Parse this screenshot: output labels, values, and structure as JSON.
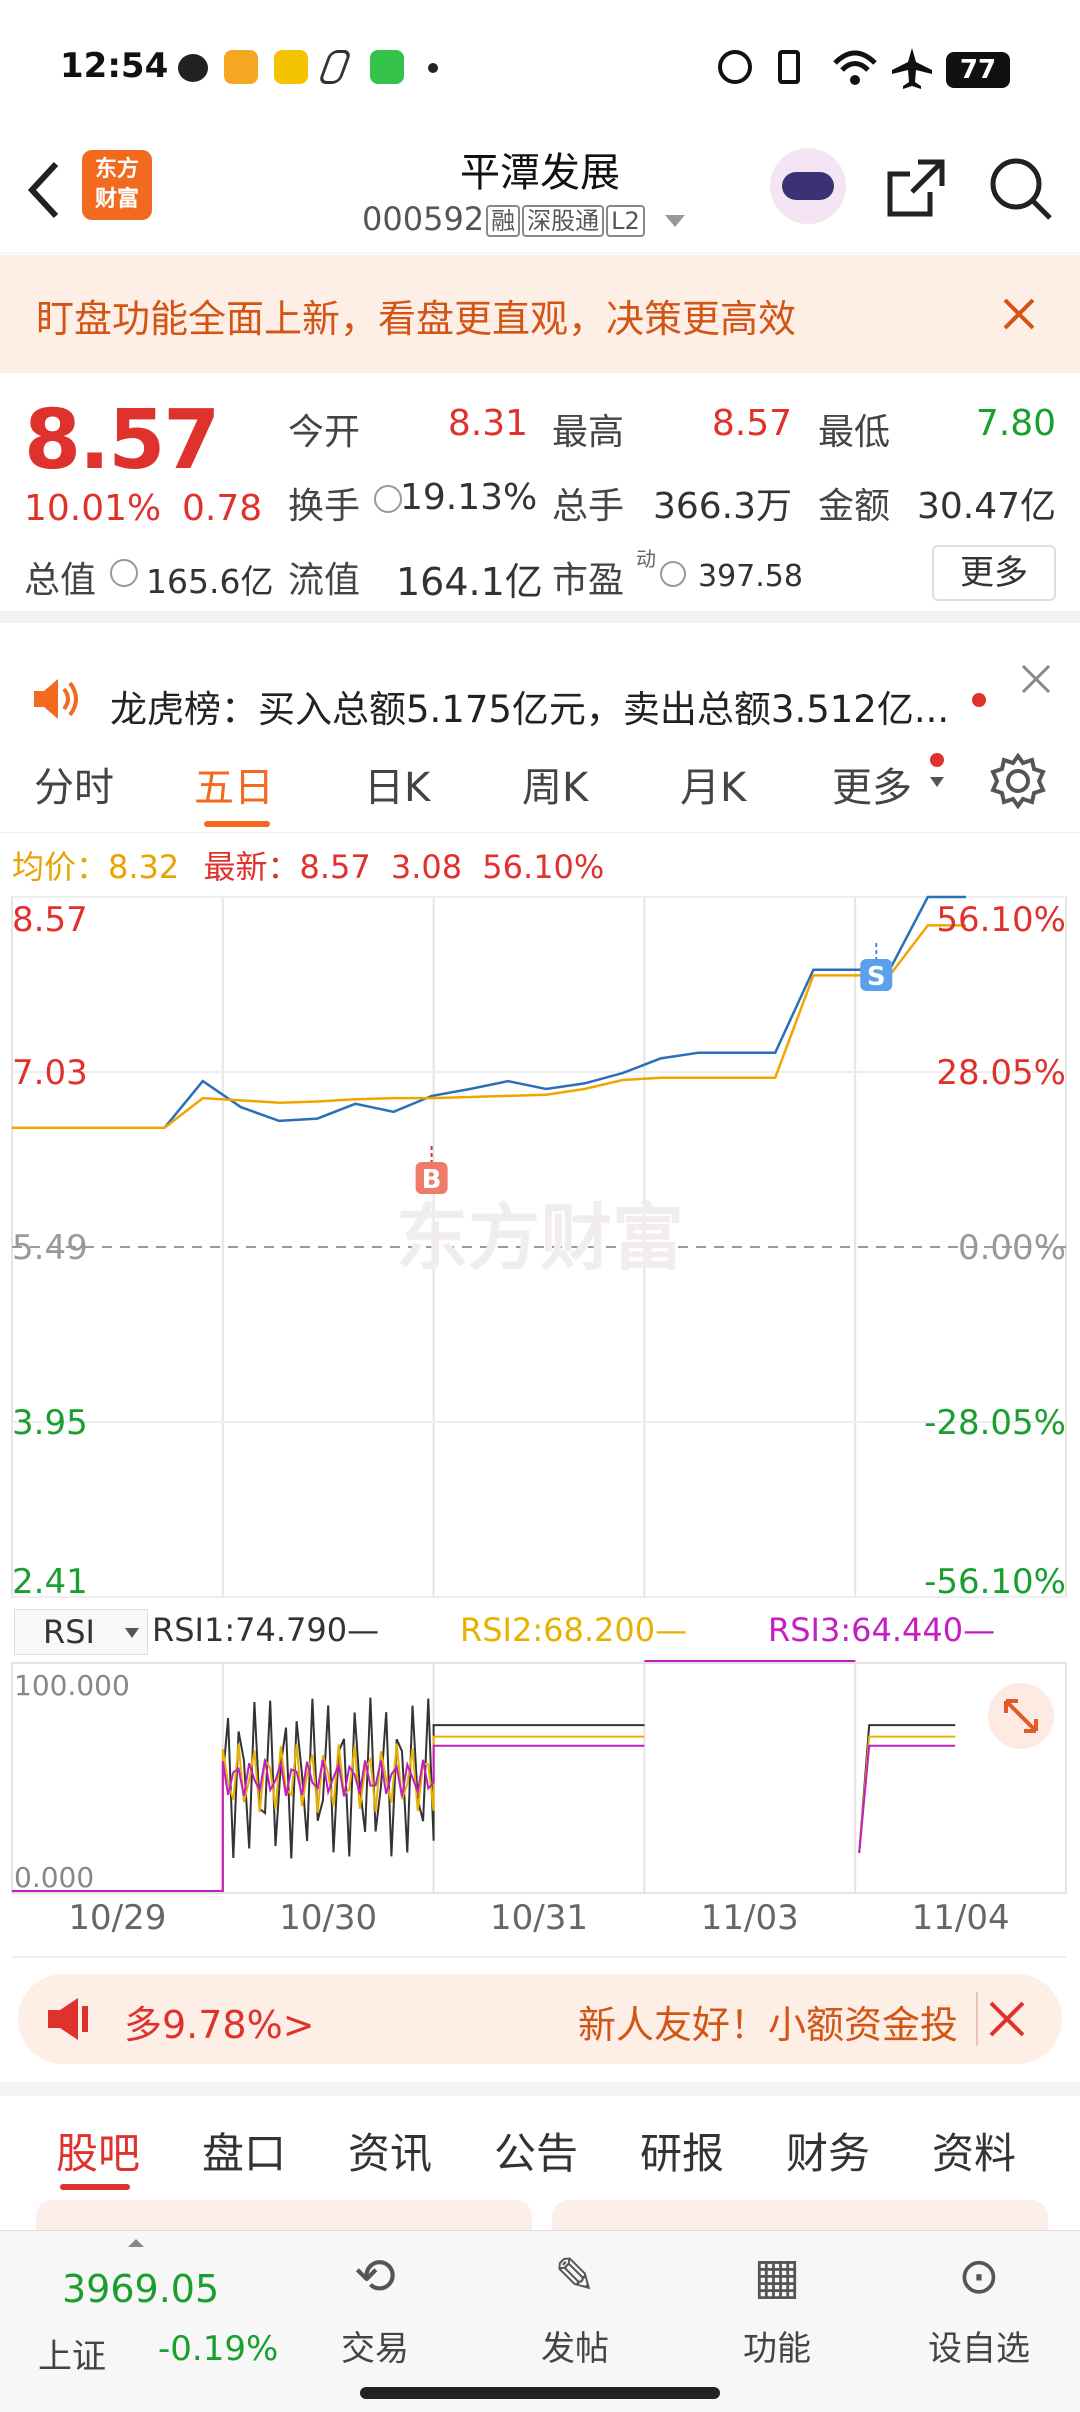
{
  "status_bar": {
    "time": "12:54",
    "battery": "77"
  },
  "header": {
    "logo_line1": "东方",
    "logo_line2": "财富",
    "name": "平潭发展",
    "code": "000592",
    "tags": [
      "融",
      "深股通",
      "L2"
    ]
  },
  "banner": {
    "text": "盯盘功能全面上新，看盘更直观，决策更高效"
  },
  "quote": {
    "price": "8.57",
    "change_pct": "10.01%",
    "change": "0.78",
    "open_label": "今开",
    "open": "8.31",
    "high_label": "最高",
    "high": "8.57",
    "low_label": "最低",
    "low": "7.80",
    "turnover_label": "换手",
    "turnover": "19.13%",
    "volume_label": "总手",
    "volume": "366.3万",
    "amount_label": "金额",
    "amount": "30.47亿",
    "mktcap_label": "总值",
    "mktcap": "165.6亿",
    "float_label": "流值",
    "float": "164.1亿",
    "pe_label": "市盈",
    "pe_sup": "动",
    "pe": "397.58",
    "more_button": "更多"
  },
  "notice": {
    "text": "龙虎榜：买入总额5.175亿元，卖出总额3.512亿..."
  },
  "chart_tabs": [
    "分时",
    "五日",
    "日K",
    "周K",
    "月K",
    "更多"
  ],
  "info_line": {
    "avg_label": "均价：",
    "avg": "8.32",
    "latest_label": "最新：",
    "latest": "8.57",
    "change": "3.08",
    "pct": "56.10%"
  },
  "watermark": "东方财富",
  "rsi": {
    "selector": "RSI",
    "rsi1": "RSI1:74.790—",
    "rsi2": "RSI2:68.200—",
    "rsi3": "RSI3:64.440—",
    "top": "100.000",
    "bottom": "0.000"
  },
  "chart_data": {
    "type": "line",
    "x": [
      "10/29",
      "10/30",
      "10/31",
      "11/03",
      "11/04"
    ],
    "y_left_ticks": [
      "8.57",
      "7.03",
      "5.49",
      "3.95",
      "2.41"
    ],
    "y_right_ticks": [
      "56.10%",
      "28.05%",
      "0.00%",
      "-28.05%",
      "-56.10%"
    ],
    "ylim": [
      2.41,
      8.57
    ],
    "base": 5.49,
    "series": [
      {
        "values": [
          6.54,
          6.54,
          6.54,
          6.54,
          6.54,
          6.95,
          6.72,
          6.6,
          6.62,
          6.75,
          6.68,
          6.82,
          6.88,
          6.95,
          6.88,
          6.93,
          7.02,
          7.15,
          7.2,
          7.2,
          7.2,
          7.93,
          7.93,
          7.93,
          8.57,
          8.57
        ],
        "color": "#2a6fb8"
      },
      {
        "values": [
          6.54,
          6.54,
          6.54,
          6.54,
          6.54,
          6.8,
          6.78,
          6.76,
          6.77,
          6.79,
          6.8,
          6.8,
          6.81,
          6.82,
          6.83,
          6.88,
          6.96,
          6.98,
          6.98,
          6.98,
          6.98,
          7.88,
          7.88,
          7.88,
          8.32,
          8.32
        ],
        "color": "#f0a500"
      }
    ],
    "markers": [
      {
        "label": "B",
        "date": "10/30"
      },
      {
        "label": "S",
        "date": "11/04"
      }
    ]
  },
  "promo": {
    "left": "多9.78%>",
    "right": "新人友好！小额资金投"
  },
  "bottom_tabs": [
    "股吧",
    "盘口",
    "资讯",
    "公告",
    "研报",
    "财务",
    "资料"
  ],
  "nav": {
    "index_value": "3969.05",
    "index_name": "上证",
    "index_change": "-0.19%",
    "items": [
      "交易",
      "发帖",
      "功能",
      "设自选"
    ]
  }
}
